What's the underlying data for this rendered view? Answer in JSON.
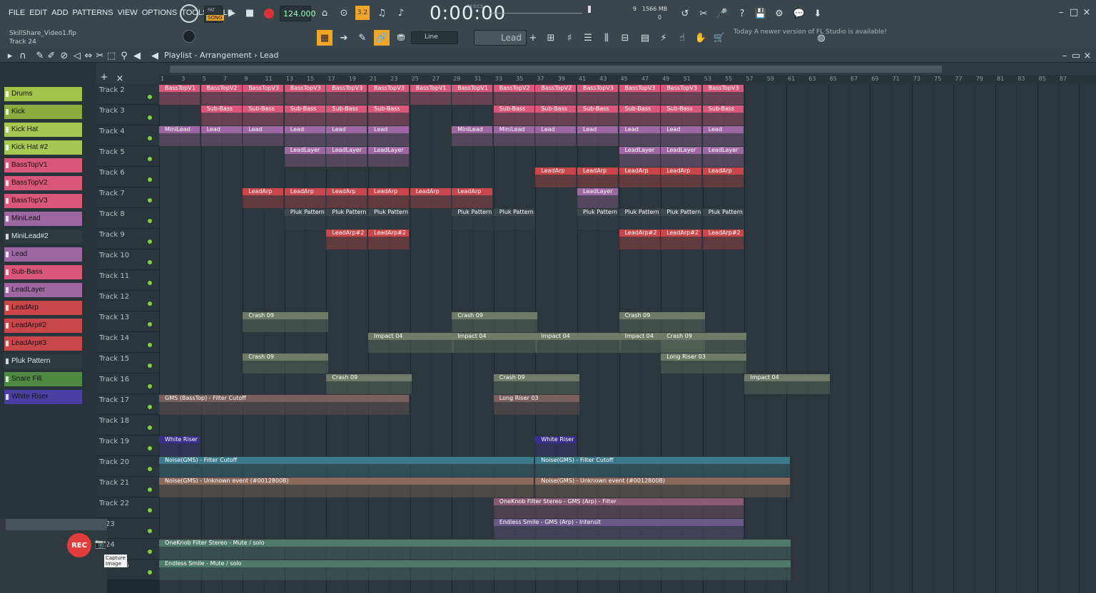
{
  "menu": [
    "FILE",
    "EDIT",
    "ADD",
    "PATTERNS",
    "VIEW",
    "OPTIONS",
    "TOOLS",
    "HELP"
  ],
  "transport": {
    "pat": "PAT",
    "song": "SONG",
    "tempo": "124.000",
    "time": "0:00:00",
    "time_unit": "M:S:CS",
    "cpu": "9",
    "ram": "1566 MB",
    "voices": "0"
  },
  "project": {
    "file": "SkillShare_Video1.flp",
    "track_hint": "Track 24"
  },
  "toolbar2": {
    "snap": "Line",
    "pattern": "Lead",
    "notice_day": "Today",
    "notice_text": "A newer version of FL Studio is available!"
  },
  "playlist": {
    "title": "Playlist - Arrangement",
    "arrow": "›",
    "pattern": "Lead"
  },
  "channels": [
    {
      "name": "Drums",
      "color": "#a4c24a"
    },
    {
      "name": "Kick",
      "color": "#8cab3e"
    },
    {
      "name": "Kick Hat",
      "color": "#a9c652"
    },
    {
      "name": "Kick Hat #2",
      "color": "#a9c652"
    },
    {
      "name": "BassTopV1",
      "color": "#d9577a"
    },
    {
      "name": "BassTopV2",
      "color": "#d9577a"
    },
    {
      "name": "BassTopV3",
      "color": "#d9577a"
    },
    {
      "name": "MiniLead",
      "color": "#9e67a2"
    },
    {
      "name": "MiniLead#2",
      "color": "#2f393e"
    },
    {
      "name": "Lead",
      "color": "#9e67a2"
    },
    {
      "name": "Sub-Bass",
      "color": "#d9577a"
    },
    {
      "name": "LeadLayer",
      "color": "#9e67a2"
    },
    {
      "name": "LeadArp",
      "color": "#c9464a"
    },
    {
      "name": "LeadArp#2",
      "color": "#c9464a"
    },
    {
      "name": "LeadArp#3",
      "color": "#c9464a"
    },
    {
      "name": "Pluk Pattern",
      "color": "#2f393e"
    },
    {
      "name": "Snare Fill",
      "color": "#4f8a43"
    },
    {
      "name": "White Riser",
      "color": "#4b3fa3"
    }
  ],
  "tracks": [
    "Track 2",
    "Track 3",
    "Track 4",
    "Track 5",
    "Track 6",
    "Track 7",
    "Track 8",
    "Track 9",
    "Track 10",
    "Track 11",
    "Track 12",
    "Track 13",
    "Track 14",
    "Track 15",
    "Track 16",
    "Track 17",
    "Track 18",
    "Track 19",
    "Track 20",
    "Track 21",
    "Track 22",
    "k 23",
    "k 24",
    "Track 25"
  ],
  "ruler": [
    "1",
    "3",
    "5",
    "7",
    "9",
    "11",
    "13",
    "15",
    "17",
    "19",
    "21",
    "23",
    "25",
    "27",
    "29",
    "31",
    "33",
    "35",
    "37",
    "39",
    "41",
    "43",
    "45",
    "47",
    "49",
    "51",
    "53",
    "55",
    "57",
    "59",
    "61",
    "63",
    "65",
    "67",
    "69",
    "71",
    "73",
    "75",
    "77",
    "79",
    "81",
    "83",
    "85",
    "87"
  ],
  "clips": [
    {
      "t": 0,
      "bars": [
        1,
        3,
        5,
        7,
        9,
        11,
        13,
        15,
        17,
        19,
        21,
        23,
        25,
        27
      ],
      "labels": [
        "BassTopV1",
        "BassTopV2",
        "BassTopV3",
        "BassTopV3",
        "BassTopV3",
        "BassTopV3",
        "BassTopV1",
        "BassTopV1",
        "BassTopV2",
        "BassTopV2",
        "BassTopV3",
        "BassTopV3",
        "BassTopV3",
        "BassTopV3"
      ],
      "color": "#d9577a"
    },
    {
      "t": 1,
      "bars": [
        3,
        5,
        7,
        9,
        11,
        17,
        19,
        21,
        23,
        25,
        27
      ],
      "labels": [
        "Sub-Bass",
        "Sub-Bass",
        "Sub-Bass",
        "Sub-Bass",
        "Sub-Bass",
        "Sub-Bass",
        "Sub-Bass",
        "Sub-Bass",
        "Sub-Bass",
        "Sub-Bass",
        "Sub-Bass"
      ],
      "color": "#d9577a"
    },
    {
      "t": 2,
      "bars": [
        1,
        3,
        5,
        7,
        9,
        11,
        15,
        17,
        19,
        21,
        23,
        25,
        27
      ],
      "labels": [
        "MiniLead",
        "Lead",
        "Lead",
        "Lead",
        "Lead",
        "Lead",
        "MiniLead",
        "MiniLead",
        "Lead",
        "Lead",
        "Lead",
        "Lead",
        "Lead"
      ],
      "color": "#9e67a2"
    },
    {
      "t": 3,
      "bars": [
        7,
        9,
        11,
        23,
        25,
        27
      ],
      "labels": [
        "LeadLayer",
        "LeadLayer",
        "LeadLayer",
        "LeadLayer",
        "LeadLayer",
        "LeadLayer"
      ],
      "color": "#9e67a2"
    },
    {
      "t": 4,
      "bars": [
        19,
        21,
        23,
        25,
        27
      ],
      "labels": [
        "LeadArp",
        "LeadArp",
        "LeadArp",
        "LeadArp",
        "LeadArp"
      ],
      "color": "#c9464a"
    },
    {
      "t": 5,
      "bars": [
        5,
        7,
        9,
        11,
        13,
        15
      ],
      "labels": [
        "LeadArp",
        "LeadArp",
        "LeadArp",
        "LeadArp",
        "LeadArp",
        "LeadArp"
      ],
      "color": "#c9464a"
    },
    {
      "t": 5,
      "bars": [
        21
      ],
      "labels": [
        "LeadLayer"
      ],
      "color": "#9e67a2"
    },
    {
      "t": 6,
      "bars": [
        7,
        9,
        11,
        15,
        17,
        21,
        23,
        25,
        27
      ],
      "labels": [
        "Pluk Pattern",
        "Pluk Pattern",
        "Pluk Pattern",
        "Pluk Pattern",
        "Pluk Pattern",
        "Pluk Pattern",
        "Pluk Pattern",
        "Pluk Pattern",
        "Pluk Pattern"
      ],
      "color": "#3d474c"
    },
    {
      "t": 7,
      "bars": [
        9,
        11,
        23,
        25,
        27
      ],
      "labels": [
        "LeadArp#2",
        "LeadArp#2",
        "LeadArp#2",
        "LeadArp#2",
        "LeadArp#2"
      ],
      "color": "#c9464a"
    },
    {
      "t": 11,
      "bars": [
        5,
        15,
        23
      ],
      "labels": [
        "Crash 09",
        "Crash 09",
        "Crash 09"
      ],
      "color": "#6f7a68"
    },
    {
      "t": 12,
      "bars": [
        11,
        15,
        19,
        23,
        25
      ],
      "labels": [
        "Impact 04",
        "Impact 04",
        "Impact 04",
        "Impact 04",
        "Crash 09"
      ],
      "color": "#6f7a68"
    },
    {
      "t": 13,
      "bars": [
        5,
        25
      ],
      "labels": [
        "Crash 09",
        "Long Riser 03"
      ],
      "color": "#6f7a68"
    },
    {
      "t": 14,
      "bars": [
        9,
        17,
        29
      ],
      "labels": [
        "Crash 09",
        "Crash 09",
        "Impact 04"
      ],
      "color": "#6f7a68"
    },
    {
      "t": 15,
      "bars": [
        1,
        17
      ],
      "labels": [
        "GMS (BassTop) - Filter Cutoff",
        "Long Riser 03"
      ],
      "color": "#7a5f5f"
    },
    {
      "t": 17,
      "bars": [
        1,
        19
      ],
      "labels": [
        "White Riser",
        "White Riser"
      ],
      "color": "#3a2f8a"
    },
    {
      "t": 18,
      "bars": [
        1,
        19
      ],
      "labels": [
        "Noise(GMS) - Filter Cutoff",
        "Noise(GMS) - Filter Cutoff"
      ],
      "color": "#3c7a8a"
    },
    {
      "t": 19,
      "bars": [
        1,
        19
      ],
      "labels": [
        "Noise(GMS) - Unknown event (#0012800B)",
        "Noise(GMS) - Unknown event (#0012800B)"
      ],
      "color": "#8a6a5a"
    },
    {
      "t": 20,
      "bars": [
        17
      ],
      "labels": [
        "OneKnob Filter Stereo - GMS (Arp) - Filter"
      ],
      "color": "#8a5a70"
    },
    {
      "t": 21,
      "bars": [
        17
      ],
      "labels": [
        "Endless Smile - GMS (Arp) - Intensit"
      ],
      "color": "#6a5a8a"
    },
    {
      "t": 22,
      "bars": [
        1
      ],
      "labels": [
        "OneKnob Filter Stereo - Mute / solo"
      ],
      "color": "#4f7a6a"
    },
    {
      "t": 23,
      "bars": [
        1
      ],
      "labels": [
        "Endless Smile - Mute / solo"
      ],
      "color": "#4f7a6a"
    }
  ],
  "rec": {
    "label": "REC",
    "tooltip": "Capture Image"
  }
}
